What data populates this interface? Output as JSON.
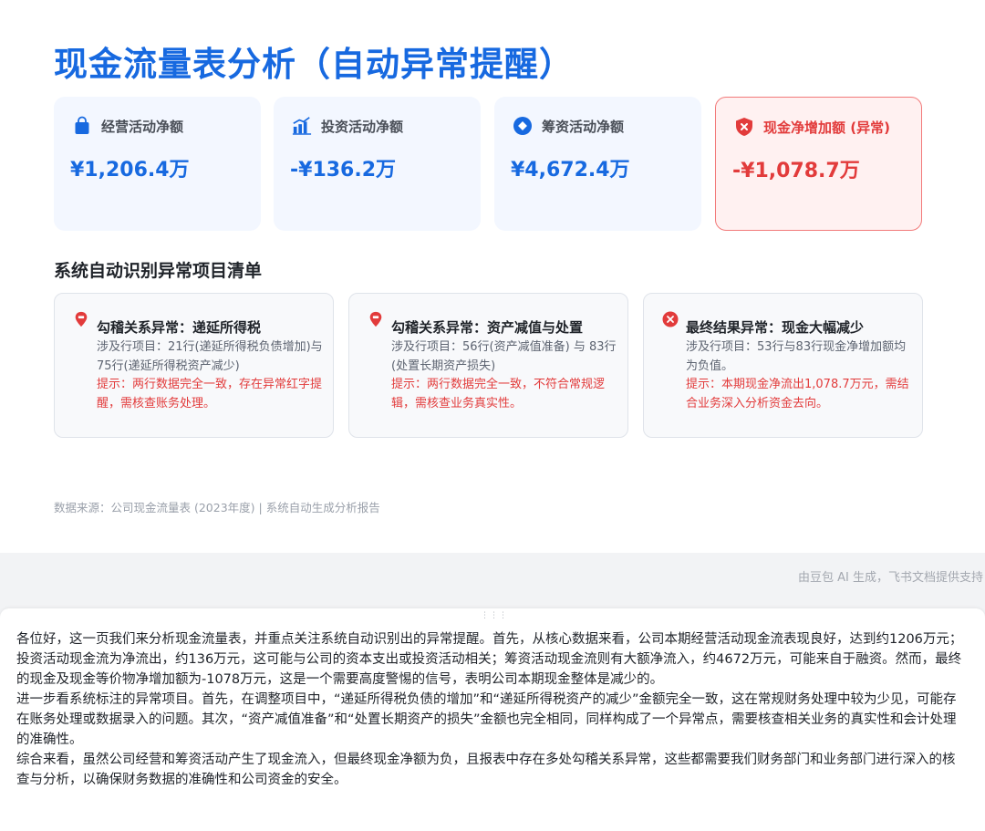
{
  "slide": {
    "title": "现金流量表分析（自动异常提醒）",
    "kpis": [
      {
        "label": "经营活动净额",
        "value": "¥1,206.4万",
        "icon": "shopping-bag-icon",
        "alert": false
      },
      {
        "label": "投资活动净额",
        "value": "-¥136.2万",
        "icon": "bar-chart-icon",
        "alert": false
      },
      {
        "label": "筹资活动净额",
        "value": "¥4,672.4万",
        "icon": "diamond-icon",
        "alert": false
      },
      {
        "label": "现金净增加额 (异常)",
        "value": "-¥1,078.7万",
        "icon": "shield-alert-icon",
        "alert": true
      }
    ],
    "section_title": "系统自动识别异常项目清单",
    "anomalies": [
      {
        "icon": "pin-alert-icon",
        "title": "勾稽关系异常：递延所得税",
        "detail": "涉及行项目：21行(递延所得税负债增加)与 75行(递延所得税资产减少)",
        "hint": "提示：两行数据完全一致，存在异常红字提醒，需核查账务处理。"
      },
      {
        "icon": "pin-alert-icon",
        "title": "勾稽关系异常：资产减值与处置",
        "detail": "涉及行项目：56行(资产减值准备) 与 83行(处置长期资产损失)",
        "hint": "提示：两行数据完全一致，不符合常规逻辑，需核查业务真实性。"
      },
      {
        "icon": "close-circle-icon",
        "title": "最终结果异常：现金大幅减少",
        "detail": "涉及行项目：53行与83行现金净增加额均为负值。",
        "hint": "提示：本期现金净流出1,078.7万元，需结合业务深入分析资金去向。"
      }
    ],
    "source": "数据来源：公司现金流量表 (2023年度) | 系统自动生成分析报告"
  },
  "attribution": "由豆包 AI 生成，飞书文档提供支持",
  "notes": {
    "paragraphs": [
      "各位好，这一页我们来分析现金流量表，并重点关注系统自动识别出的异常提醒。首先，从核心数据来看，公司本期经营活动现金流表现良好，达到约1206万元；投资活动现金流为净流出，约136万元，这可能与公司的资本支出或投资活动相关；筹资活动现金流则有大额净流入，约4672万元，可能来自于融资。然而，最终的现金及现金等价物净增加额为-1078万元，这是一个需要高度警惕的信号，表明公司本期现金整体是减少的。",
      "进一步看系统标注的异常项目。首先，在调整项目中，“递延所得税负债的增加”和“递延所得税资产的减少”金额完全一致，这在常规财务处理中较为少见，可能存在账务处理或数据录入的问题。其次，“资产减值准备”和“处置长期资产的损失”金额也完全相同，同样构成了一个异常点，需要核查相关业务的真实性和会计处理的准确性。",
      "综合来看，虽然公司经营和筹资活动产生了现金流入，但最终现金净额为负，且报表中存在多处勾稽关系异常，这些都需要我们财务部门和业务部门进行深入的核查与分析，以确保财务数据的准确性和公司资金的安全。"
    ]
  },
  "colors": {
    "accent": "#1769e0",
    "alert": "#e23b3b",
    "card_bg": "#f3f7ff",
    "alert_bg": "#fff1f1"
  }
}
